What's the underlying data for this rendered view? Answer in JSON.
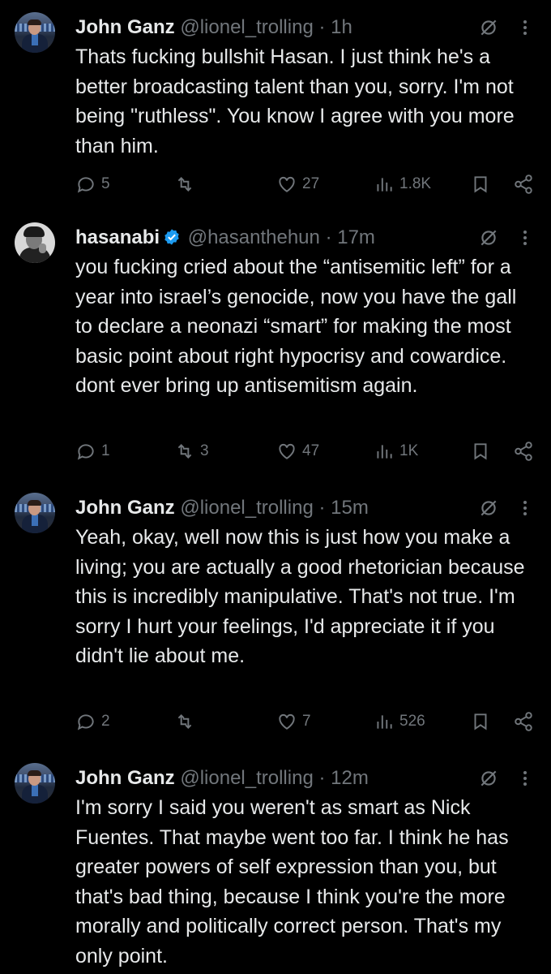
{
  "tweets": [
    {
      "avatar": "john-ganz-avatar",
      "name": "John Ganz",
      "handle": "@lionel_trolling",
      "separator": "·",
      "time": "1h",
      "verified": false,
      "text": "Thats fucking bullshit Hasan. I just think he's a better broadcasting talent than you, sorry. I'm not being \"ruthless\". You know I agree with you more than him.",
      "replies": "5",
      "reposts": "",
      "likes": "27",
      "views": "1.8K"
    },
    {
      "avatar": "hasanabi-avatar",
      "name": "hasanabi",
      "handle": "@hasanthehun",
      "separator": "·",
      "time": "17m",
      "verified": true,
      "text": "you fucking cried about the “antisemitic left” for a year into israel’s genocide, now you have the gall to declare a neonazi “smart” for making the most basic point about right hypocrisy and cowardice. dont ever bring up antisemitism again.",
      "replies": "1",
      "reposts": "3",
      "likes": "47",
      "views": "1K"
    },
    {
      "avatar": "john-ganz-avatar",
      "name": "John Ganz",
      "handle": "@lionel_trolling",
      "separator": "·",
      "time": "15m",
      "verified": false,
      "text": "Yeah, okay, well now this is just how you make a living; you are actually a good rhetorician because this is incredibly manipulative. That's not true. I'm sorry I hurt your feelings, I'd appreciate it if you didn't lie about me.",
      "replies": "2",
      "reposts": "",
      "likes": "7",
      "views": "526"
    },
    {
      "avatar": "john-ganz-avatar",
      "name": "John Ganz",
      "handle": "@lionel_trolling",
      "separator": "·",
      "time": "12m",
      "verified": false,
      "text": "I'm sorry I said you weren't as smart as Nick Fuentes. That maybe went too far. I think he has greater powers of self expression than you, but that's bad thing, because I think you're the more morally and politically correct person. That's my only point.",
      "replies": "",
      "reposts": "",
      "likes": "",
      "views": ""
    }
  ],
  "colors": {
    "background": "#000000",
    "text": "#e7e9ea",
    "muted": "#71767b",
    "verified": "#1d9bf0"
  },
  "icons": [
    "reply-icon",
    "repost-icon",
    "like-icon",
    "views-icon",
    "bookmark-icon",
    "share-icon",
    "grok-icon",
    "more-icon",
    "verified-badge-icon"
  ]
}
